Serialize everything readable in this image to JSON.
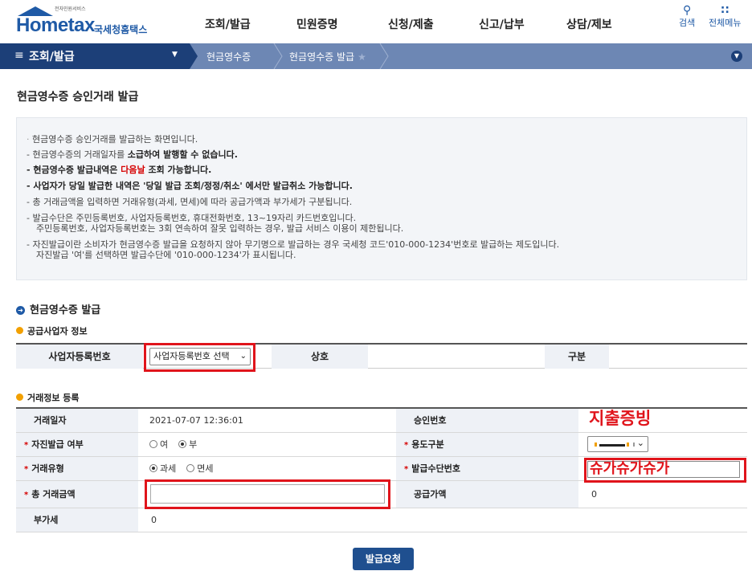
{
  "header": {
    "logo_small": "전자민원서비스",
    "logo_home": "Hometax",
    "logo_agency": "국세청홈택스",
    "menu": [
      "조회/발급",
      "민원증명",
      "신청/제출",
      "신고/납부",
      "상담/제보"
    ],
    "search_label": "검색",
    "all_menu_label": "전체메뉴"
  },
  "nav": {
    "main_label": "조회/발급",
    "crumbs": [
      "현금영수증",
      "현금영수증 발급"
    ]
  },
  "page_title": "현금영수증 승인거래 발급",
  "info": {
    "line1": "현금영수증 승인거래를 발급하는 화면입니다.",
    "line2a": "- 현금영수증의 거래일자를 ",
    "line2b": "소급하여 발행할 수 없습니다.",
    "line3a": "- 현금영수증 발급내역은 ",
    "line3b": "다음날",
    "line3c": " 조회 가능합니다.",
    "line4": "- 사업자가 당일 발급한 내역은 '당일 발급 조회/정정/취소' 에서만 발급취소 가능합니다.",
    "line5": "- 총 거래금액을 입력하면 거래유형(과세, 면세)에 따라 공급가액과 부가세가 구분됩니다.",
    "line6a": "- 발급수단은 주민등록번호, 사업자등록번호, 휴대전화번호, 13~19자리 카드번호입니다.",
    "line6b": "주민등록번호, 사업자등록번호는 3회 연속하여 잘못 입력하는 경우, 발급 서비스 이용이 제한됩니다.",
    "line7a": "- 자진발급이란 소비자가 현금영수증 발급을 요청하지 않아 무기명으로 발급하는 경우 국세청 코드'010-000-1234'번호로 발급하는 제도입니다.",
    "line7b": "자진발급 '여'를 선택하면 발급수단에 '010-000-1234'가 표시됩니다."
  },
  "section_title": "현금영수증 발급",
  "supplier": {
    "title": "공급사업자 정보",
    "biz_no_label": "사업자등록번호",
    "biz_no_select": "사업자등록번호 선택",
    "name_label": "상호",
    "type_label": "구분"
  },
  "transaction": {
    "title": "거래정보 등록",
    "date_label": "거래일자",
    "date_value": "2021-07-07 12:36:01",
    "approval_label": "승인번호",
    "self_issue_label": "자진발급 여부",
    "self_yes": "여",
    "self_no": "부",
    "usage_label": "용도구분",
    "trade_type_label": "거래유형",
    "taxable": "과세",
    "tax_free": "면세",
    "issue_means_label": "발급수단번호",
    "total_label": "총 거래금액",
    "total_value": "",
    "supply_label": "공급가액",
    "supply_value": "0",
    "vat_label": "부가세",
    "vat_value": "0"
  },
  "overlays": {
    "expense_proof": "지출증빙",
    "means_text": "슈가슈가슈가"
  },
  "submit_label": "발급요청",
  "colors": {
    "brand": "#1f5aa6",
    "nav_dark": "#1c3f78",
    "nav_light": "#6d87b4",
    "highlight_red": "#e0141b"
  }
}
